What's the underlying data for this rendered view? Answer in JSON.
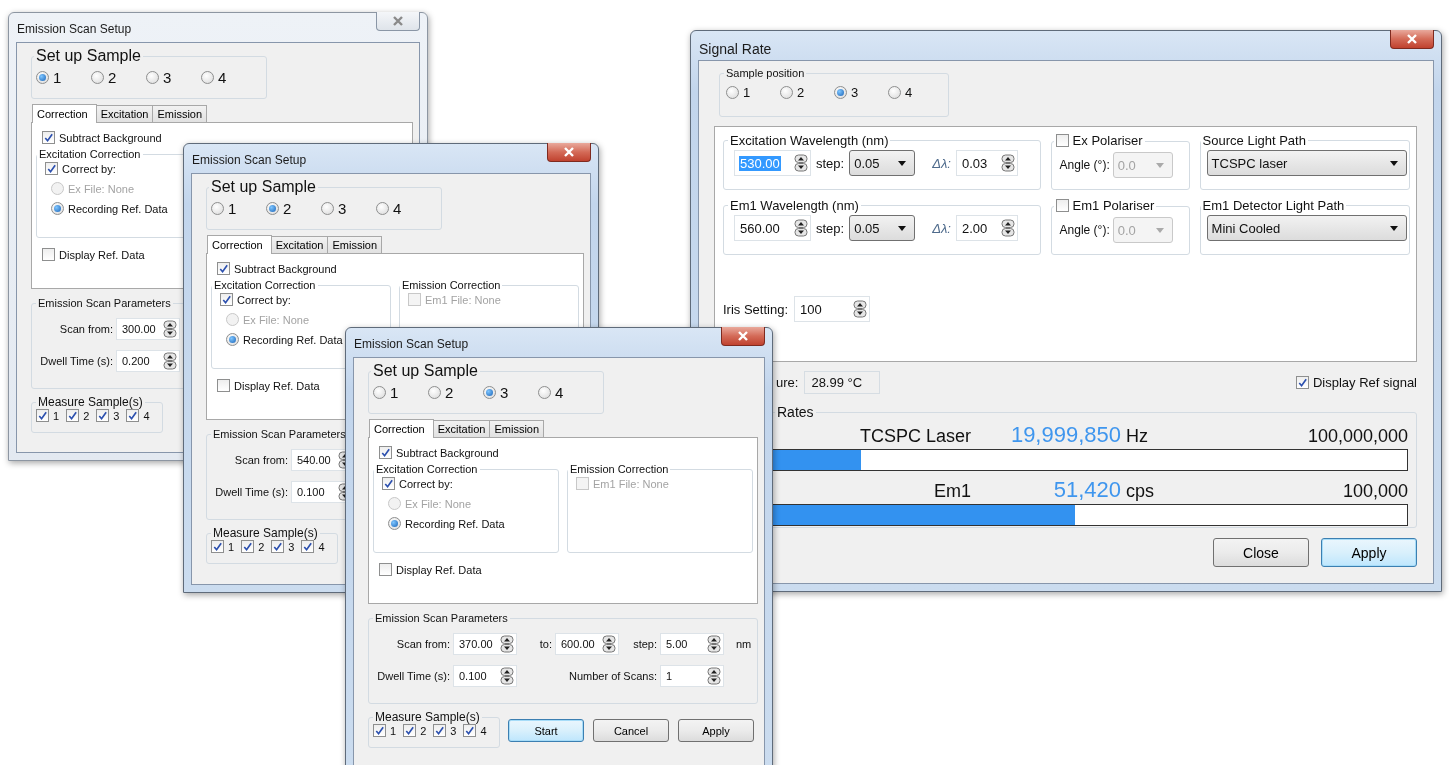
{
  "dialogs": [
    {
      "title": "Emission Scan Setup",
      "active": false,
      "sample_group": {
        "label": "Set up Sample",
        "options": [
          {
            "label": "1",
            "selected": true
          },
          {
            "label": "2",
            "selected": false
          },
          {
            "label": "3",
            "selected": false
          },
          {
            "label": "4",
            "selected": false
          }
        ]
      },
      "tabs": [
        {
          "label": "Correction",
          "selected": true
        },
        {
          "label": "Excitation",
          "selected": false
        },
        {
          "label": "Emission",
          "selected": false
        }
      ],
      "subtract_background": {
        "label": "Subtract Background",
        "checked": true
      },
      "excitation_correction": {
        "label": "Excitation Correction",
        "correct_by": {
          "label": "Correct by:",
          "checked": true
        },
        "options": [
          {
            "label": "Ex File: None",
            "selected": false,
            "disabled": true
          },
          {
            "label": "Recording Ref. Data",
            "selected": true,
            "disabled": false
          }
        ]
      },
      "display_ref": {
        "label": "Display Ref. Data",
        "checked": false
      },
      "scan_parameters": {
        "label": "Emission Scan Parameters",
        "rows": [
          {
            "fields": [
              {
                "label": "Scan from:",
                "value": "300.00"
              }
            ]
          },
          {
            "fields": [
              {
                "label": "Dwell Time (s):",
                "value": "0.200"
              }
            ]
          }
        ]
      },
      "measure_samples": {
        "label": "Measure Sample(s)",
        "items": [
          {
            "label": "1",
            "checked": true
          },
          {
            "label": "2",
            "checked": true
          },
          {
            "label": "3",
            "checked": true
          },
          {
            "label": "4",
            "checked": true
          }
        ]
      }
    },
    {
      "title": "Emission Scan Setup",
      "active": true,
      "sample_group": {
        "label": "Set up Sample",
        "options": [
          {
            "label": "1",
            "selected": false
          },
          {
            "label": "2",
            "selected": true
          },
          {
            "label": "3",
            "selected": false
          },
          {
            "label": "4",
            "selected": false
          }
        ]
      },
      "tabs": [
        {
          "label": "Correction",
          "selected": true
        },
        {
          "label": "Excitation",
          "selected": false
        },
        {
          "label": "Emission",
          "selected": false
        }
      ],
      "subtract_background": {
        "label": "Subtract Background",
        "checked": true
      },
      "excitation_correction": {
        "label": "Excitation Correction",
        "correct_by": {
          "label": "Correct by:",
          "checked": true
        },
        "options": [
          {
            "label": "Ex File: None",
            "selected": false,
            "disabled": true
          },
          {
            "label": "Recording Ref. Data",
            "selected": true,
            "disabled": false
          }
        ]
      },
      "emission_correction": {
        "label": "Emission Correction",
        "file": {
          "label": "Em1 File: None",
          "checked": false,
          "disabled": true
        }
      },
      "display_ref": {
        "label": "Display Ref. Data",
        "checked": false
      },
      "scan_parameters": {
        "label": "Emission Scan Parameters",
        "rows": [
          {
            "fields": [
              {
                "label": "Scan from:",
                "value": "540.00"
              }
            ]
          },
          {
            "fields": [
              {
                "label": "Dwell Time (s):",
                "value": "0.100"
              }
            ]
          }
        ]
      },
      "measure_samples": {
        "label": "Measure Sample(s)",
        "items": [
          {
            "label": "1",
            "checked": true
          },
          {
            "label": "2",
            "checked": true
          },
          {
            "label": "3",
            "checked": true
          },
          {
            "label": "4",
            "checked": true
          }
        ]
      }
    },
    {
      "title": "Emission Scan Setup",
      "active": true,
      "sample_group": {
        "label": "Set up Sample",
        "options": [
          {
            "label": "1",
            "selected": false
          },
          {
            "label": "2",
            "selected": false
          },
          {
            "label": "3",
            "selected": true
          },
          {
            "label": "4",
            "selected": false
          }
        ]
      },
      "tabs": [
        {
          "label": "Correction",
          "selected": true
        },
        {
          "label": "Excitation",
          "selected": false
        },
        {
          "label": "Emission",
          "selected": false
        }
      ],
      "subtract_background": {
        "label": "Subtract Background",
        "checked": true
      },
      "excitation_correction": {
        "label": "Excitation Correction",
        "correct_by": {
          "label": "Correct by:",
          "checked": true
        },
        "options": [
          {
            "label": "Ex File: None",
            "selected": false,
            "disabled": true
          },
          {
            "label": "Recording Ref. Data",
            "selected": true,
            "disabled": false
          }
        ]
      },
      "emission_correction": {
        "label": "Emission Correction",
        "file": {
          "label": "Em1 File: None",
          "checked": false,
          "disabled": true
        }
      },
      "display_ref": {
        "label": "Display Ref. Data",
        "checked": false
      },
      "scan_parameters": {
        "label": "Emission Scan Parameters",
        "rows": [
          {
            "fields": [
              {
                "label": "Scan from:",
                "value": "370.00"
              },
              {
                "label": "to:",
                "value": "600.00"
              },
              {
                "label": "step:",
                "value": "5.00"
              }
            ],
            "unit": "nm"
          },
          {
            "fields": [
              {
                "label": "Dwell Time (s):",
                "value": "0.100"
              },
              {
                "label": "Number of Scans:",
                "value": "1"
              }
            ]
          }
        ]
      },
      "measure_samples": {
        "label": "Measure Sample(s)",
        "items": [
          {
            "label": "1",
            "checked": true
          },
          {
            "label": "2",
            "checked": true
          },
          {
            "label": "3",
            "checked": true
          },
          {
            "label": "4",
            "checked": true
          }
        ]
      },
      "buttons": [
        {
          "label": "Start",
          "default": true
        },
        {
          "label": "Cancel",
          "default": false
        },
        {
          "label": "Apply",
          "default": false
        }
      ]
    }
  ],
  "signal_rate": {
    "title": "Signal Rate",
    "active": true,
    "sample_position": {
      "label": "Sample position",
      "options": [
        {
          "label": "1",
          "selected": false
        },
        {
          "label": "2",
          "selected": false
        },
        {
          "label": "3",
          "selected": true
        },
        {
          "label": "4",
          "selected": false
        }
      ]
    },
    "wavelength_rows": [
      {
        "label": "Excitation Wavelength (nm)",
        "value": "530.00",
        "value_selected": true,
        "step_label": "step:",
        "step": "0.05",
        "delta_label": "Δλ:",
        "delta": "0.03",
        "polariser": {
          "label": "Ex Polariser",
          "checked": false
        },
        "angle_label": "Angle (°):",
        "angle": "0.0",
        "path": {
          "label": "Source Light Path",
          "value": "TCSPC laser"
        }
      },
      {
        "label": "Em1 Wavelength (nm)",
        "value": "560.00",
        "value_selected": false,
        "step_label": "step:",
        "step": "0.05",
        "delta_label": "Δλ:",
        "delta": "2.00",
        "polariser": {
          "label": "Em1 Polariser",
          "checked": false
        },
        "angle_label": "Angle (°):",
        "angle": "0.0",
        "path": {
          "label": "Em1 Detector Light Path",
          "value": "Mini Cooled"
        }
      }
    ],
    "iris": {
      "label": "Iris Setting:",
      "value": "100"
    },
    "temperature": {
      "label": "ure:",
      "value": "28.99 °C"
    },
    "display_ref": {
      "label": "Display Ref signal",
      "checked": true
    },
    "rates": {
      "label": "Rates",
      "meters": [
        {
          "name": "TCSPC Laser",
          "value": "19,999,850",
          "unit": "Hz",
          "max": "100,000,000",
          "level": 0.2
        },
        {
          "name": "Em1",
          "value": "51,420",
          "unit": "cps",
          "max": "100,000",
          "level": 0.514
        }
      ]
    },
    "buttons": [
      {
        "label": "Close",
        "default": false
      },
      {
        "label": "Apply",
        "default": true
      }
    ]
  }
}
